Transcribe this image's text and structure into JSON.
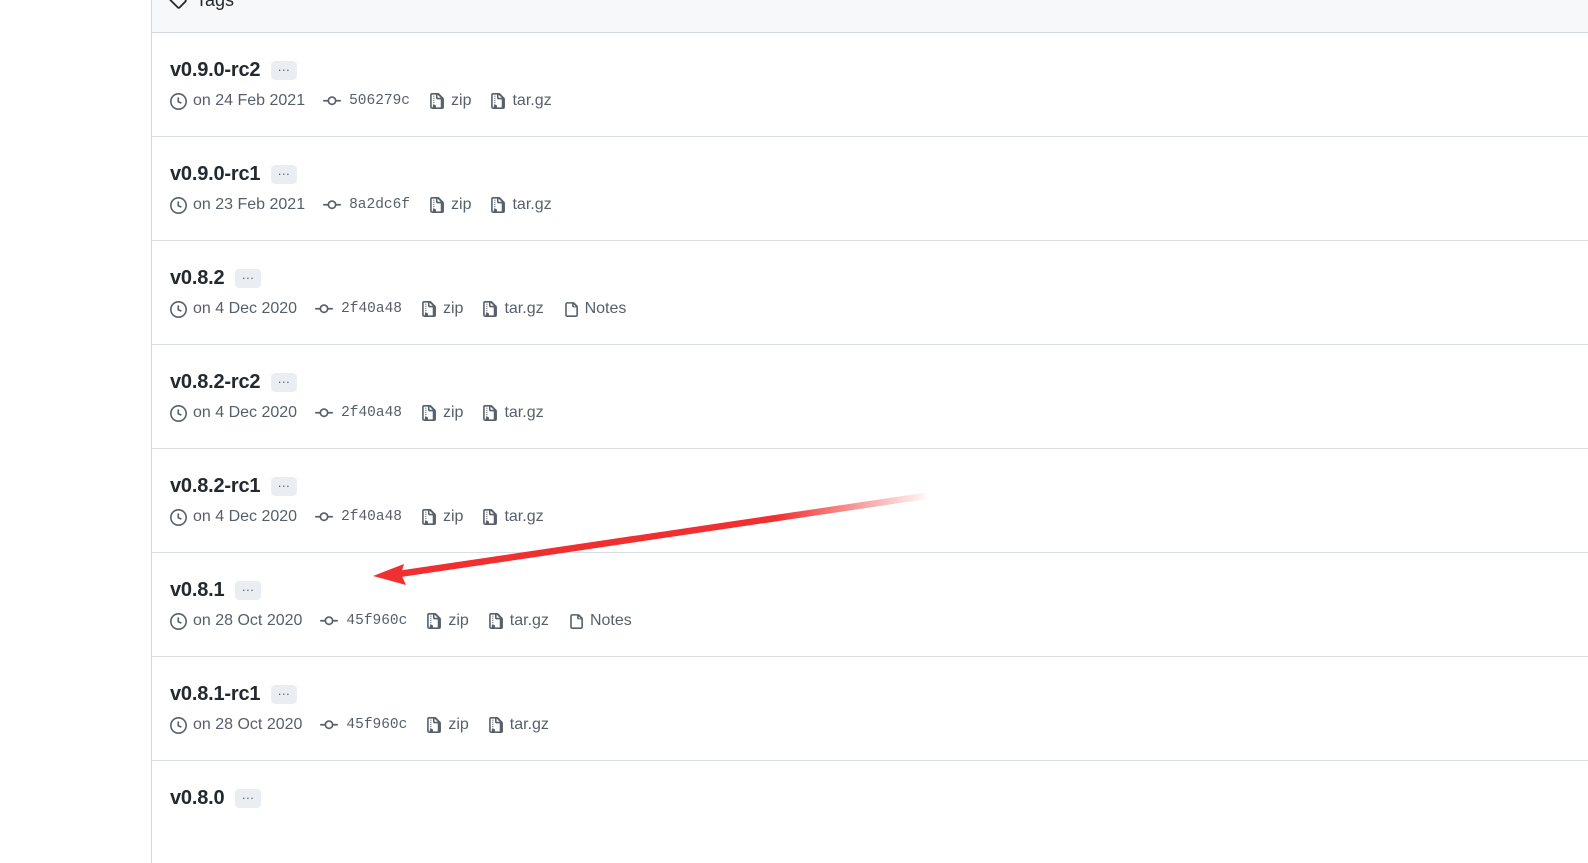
{
  "header": {
    "title": "Tags",
    "icon": "tag-icon"
  },
  "labels": {
    "ellipsis": "…",
    "zip": "zip",
    "targz": "tar.gz",
    "notes": "Notes"
  },
  "icons": {
    "clock": "clock-icon",
    "commit": "git-commit-icon",
    "file_zip": "file-zip-icon",
    "note": "note-file-icon",
    "tag": "tag-icon"
  },
  "colors": {
    "text_primary": "#24292f",
    "text_muted": "#57606a",
    "border": "#d0d7de",
    "header_bg": "#f6f8fa",
    "badge_bg": "#eaeef2",
    "link": "#0969da",
    "annotation": "#f03030"
  },
  "tags": [
    {
      "name": "v0.9.0-rc2",
      "date": "on 24 Feb 2021",
      "commit": "506279c",
      "zip": "zip",
      "targz": "tar.gz",
      "notes": null
    },
    {
      "name": "v0.9.0-rc1",
      "date": "on 23 Feb 2021",
      "commit": "8a2dc6f",
      "zip": "zip",
      "targz": "tar.gz",
      "notes": null
    },
    {
      "name": "v0.8.2",
      "date": "on 4 Dec 2020",
      "commit": "2f40a48",
      "zip": "zip",
      "targz": "tar.gz",
      "notes": "Notes"
    },
    {
      "name": "v0.8.2-rc2",
      "date": "on 4 Dec 2020",
      "commit": "2f40a48",
      "zip": "zip",
      "targz": "tar.gz",
      "notes": null
    },
    {
      "name": "v0.8.2-rc1",
      "date": "on 4 Dec 2020",
      "commit": "2f40a48",
      "zip": "zip",
      "targz": "tar.gz",
      "notes": null
    },
    {
      "name": "v0.8.1",
      "date": "on 28 Oct 2020",
      "commit": "45f960c",
      "zip": "zip",
      "targz": "tar.gz",
      "notes": "Notes"
    },
    {
      "name": "v0.8.1-rc1",
      "date": "on 28 Oct 2020",
      "commit": "45f960c",
      "zip": "zip",
      "targz": "tar.gz",
      "notes": null
    },
    {
      "name": "v0.8.0",
      "date": null,
      "commit": null,
      "zip": null,
      "targz": null,
      "notes": null
    }
  ]
}
